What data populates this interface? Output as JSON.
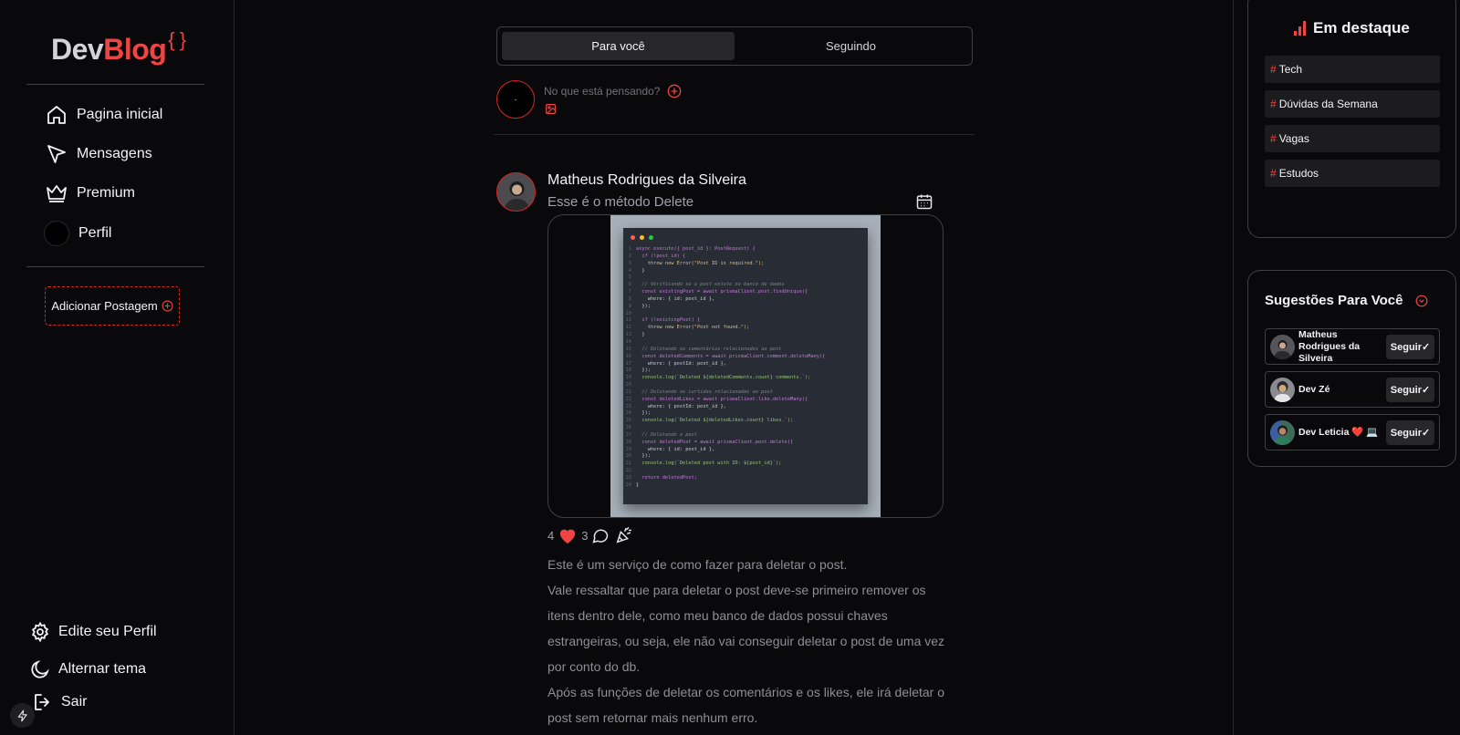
{
  "brand": {
    "part1": "Dev",
    "part2": "Blog",
    "suffix": "{ }"
  },
  "sidebar": {
    "nav": [
      {
        "label": "Pagina inicial",
        "icon": "home-icon"
      },
      {
        "label": "Mensagens",
        "icon": "send-icon"
      },
      {
        "label": "Premium",
        "icon": "crown-icon"
      },
      {
        "label": "Perfil",
        "icon": "avatar"
      }
    ],
    "add_post_label": "Adicionar Postagem",
    "bottom": [
      {
        "label": "Edite seu Perfil",
        "icon": "gear-icon"
      },
      {
        "label": "Alternar tema",
        "icon": "moon-icon"
      },
      {
        "label": "Sair",
        "icon": "logout-icon"
      }
    ]
  },
  "feed": {
    "tabs": [
      {
        "label": "Para você",
        "active": true
      },
      {
        "label": "Seguindo",
        "active": false
      }
    ],
    "composer": {
      "avatar_text": "-",
      "placeholder": "No que está pensando?"
    },
    "post": {
      "author": "Matheus Rodrigues da Silveira",
      "title": "Esse é o método Delete",
      "likes": "4",
      "comments": "3",
      "body": [
        "Este é um serviço de como fazer para deletar o post.",
        "Vale ressaltar que para deletar o post deve-se primeiro remover os itens dentro dele, como meu banco de dados possui chaves estrangeiras, ou seja, ele não vai conseguir deletar o post de uma vez por conto do db.",
        "Após as funções de deletar os comentários e os likes, ele irá deletar o post sem retornar mais nenhum erro."
      ],
      "code": [
        "async execute({ post_id }: PostRequest) {",
        "  if (!post_id) {",
        "    throw new Error(\"Post ID is required.\");",
        "  }",
        "",
        "  // Verificando se o post existe no banco de dados",
        "  const existingPost = await prismaClient.post.findUnique({",
        "    where: { id: post_id },",
        "  });",
        "",
        "  if (!existingPost) {",
        "    throw new Error(\"Post not found.\");",
        "  }",
        "",
        "  // Deletando os comentários relacionados ao post",
        "  const deletedComments = await prismaClient.comment.deleteMany({",
        "    where: { postId: post_id },",
        "  });",
        "  console.log(`Deleted ${deletedComments.count} comments.`);",
        "",
        "  // Deletando as curtidas relacionadas ao post",
        "  const deletedLikes = await prismaClient.like.deleteMany({",
        "    where: { postId: post_id },",
        "  });",
        "  console.log(`Deleted ${deletedLikes.count} likes.`);",
        "",
        "  // Deletando o post",
        "  const deletedPost = await prismaClient.post.delete({",
        "    where: { id: post_id },",
        "  });",
        "  console.log(`Deleted post with ID: ${post_id}`);",
        "",
        "  return deletedPost;",
        "}"
      ]
    }
  },
  "trending": {
    "title": "Em destaque",
    "tags": [
      "Tech",
      "Dúvidas da Semana",
      "Vagas",
      "Estudos"
    ]
  },
  "suggestions": {
    "title": "Sugestões Para Você",
    "follow_label": "Seguir✓",
    "users": [
      {
        "name": "Matheus Rodrigues da Silveira"
      },
      {
        "name": "Dev Zé"
      },
      {
        "name": "Dev Leticia ❤️ 💻"
      }
    ]
  },
  "colors": {
    "accent": "#ef4444",
    "background": "#09090b",
    "card": "#1c1c1f"
  }
}
